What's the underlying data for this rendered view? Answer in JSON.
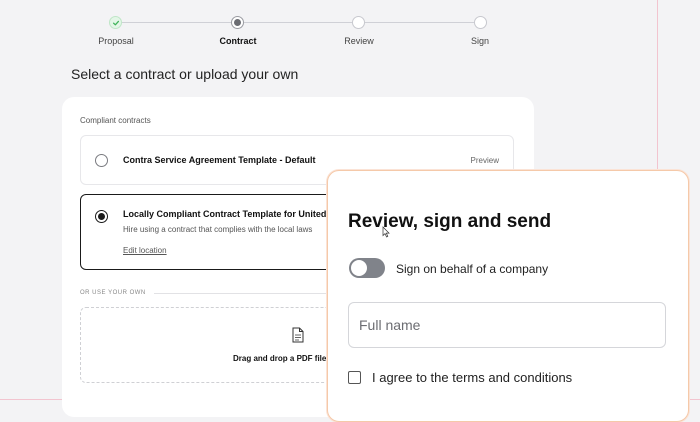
{
  "stepper": {
    "steps": [
      {
        "label": "Proposal",
        "state": "done"
      },
      {
        "label": "Contract",
        "state": "active"
      },
      {
        "label": "Review",
        "state": "upcoming"
      },
      {
        "label": "Sign",
        "state": "upcoming"
      }
    ]
  },
  "page": {
    "title": "Select a contract or upload your own"
  },
  "contracts": {
    "section_label": "Compliant contracts",
    "option1": {
      "title": "Contra Service Agreement Template - Default",
      "action": "Preview",
      "selected": false
    },
    "option2": {
      "title": "Locally Compliant Contract Template for United",
      "description": "Hire using a contract that complies with the local laws",
      "link": "Edit location",
      "selected": true
    },
    "or_label": "OR USE YOUR OWN",
    "dropzone_text": "Drag and drop a PDF file or",
    "dropzone_icon": "document-icon"
  },
  "modal": {
    "title": "Review, sign and send",
    "toggle_label": "Sign on behalf of a company",
    "toggle_on": false,
    "fullname_placeholder": "Full name",
    "fullname_value": "",
    "agree_label": "I agree to the terms and conditions",
    "agree_checked": false
  },
  "colors": {
    "accent_done": "#3fb35a",
    "border_dark": "#1a1a1a",
    "modal_border": "#f5c9a9",
    "toggle_off": "#80838a"
  }
}
